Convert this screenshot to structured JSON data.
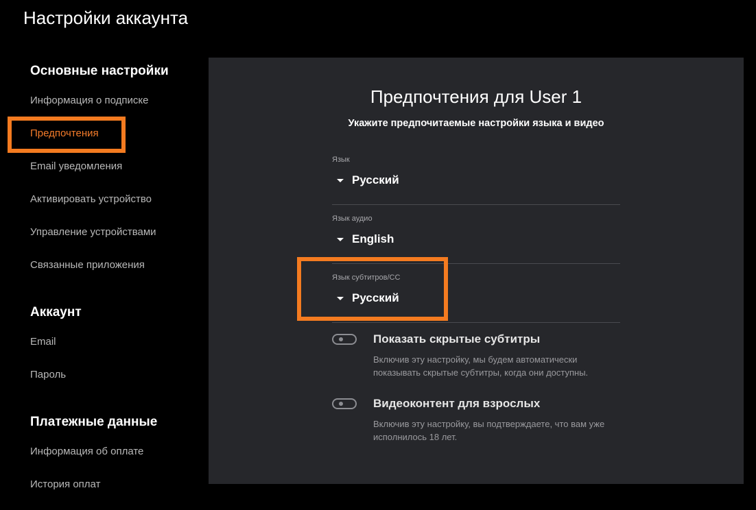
{
  "page": {
    "title": "Настройки аккаунта"
  },
  "sidebar": {
    "sections": [
      {
        "heading": "Основные настройки",
        "items": [
          "Информация о подписке",
          "Предпочтения",
          "Email уведомления",
          "Активировать устройство",
          "Управление устройствами",
          "Связанные приложения"
        ]
      },
      {
        "heading": "Аккаунт",
        "items": [
          "Email",
          "Пароль"
        ]
      },
      {
        "heading": "Платежные данные",
        "items": [
          "Информация об оплате",
          "История оплат"
        ]
      }
    ],
    "active_item": "Предпочтения"
  },
  "panel": {
    "title": "Предпочтения для User 1",
    "subtitle": "Укажите предпочитаемые настройки языка и видео",
    "fields": [
      {
        "label": "Язык",
        "value": "Русский"
      },
      {
        "label": "Язык аудио",
        "value": "English"
      },
      {
        "label": "Язык субтитров/CC",
        "value": "Русский"
      }
    ],
    "toggles": [
      {
        "title": "Показать скрытые субтитры",
        "description": "Включив эту настройку, мы будем автоматически показывать скрытые субтитры, когда они доступны.",
        "enabled": false
      },
      {
        "title": "Видеоконтент для взрослых",
        "description": "Включив эту настройку, вы подтверждаете, что вам уже исполнилось 18 лет.",
        "enabled": false
      }
    ]
  },
  "colors": {
    "accent": "#f57c2a",
    "highlight": "#f47b20",
    "panel_bg": "#26272b",
    "page_bg": "#000000"
  }
}
